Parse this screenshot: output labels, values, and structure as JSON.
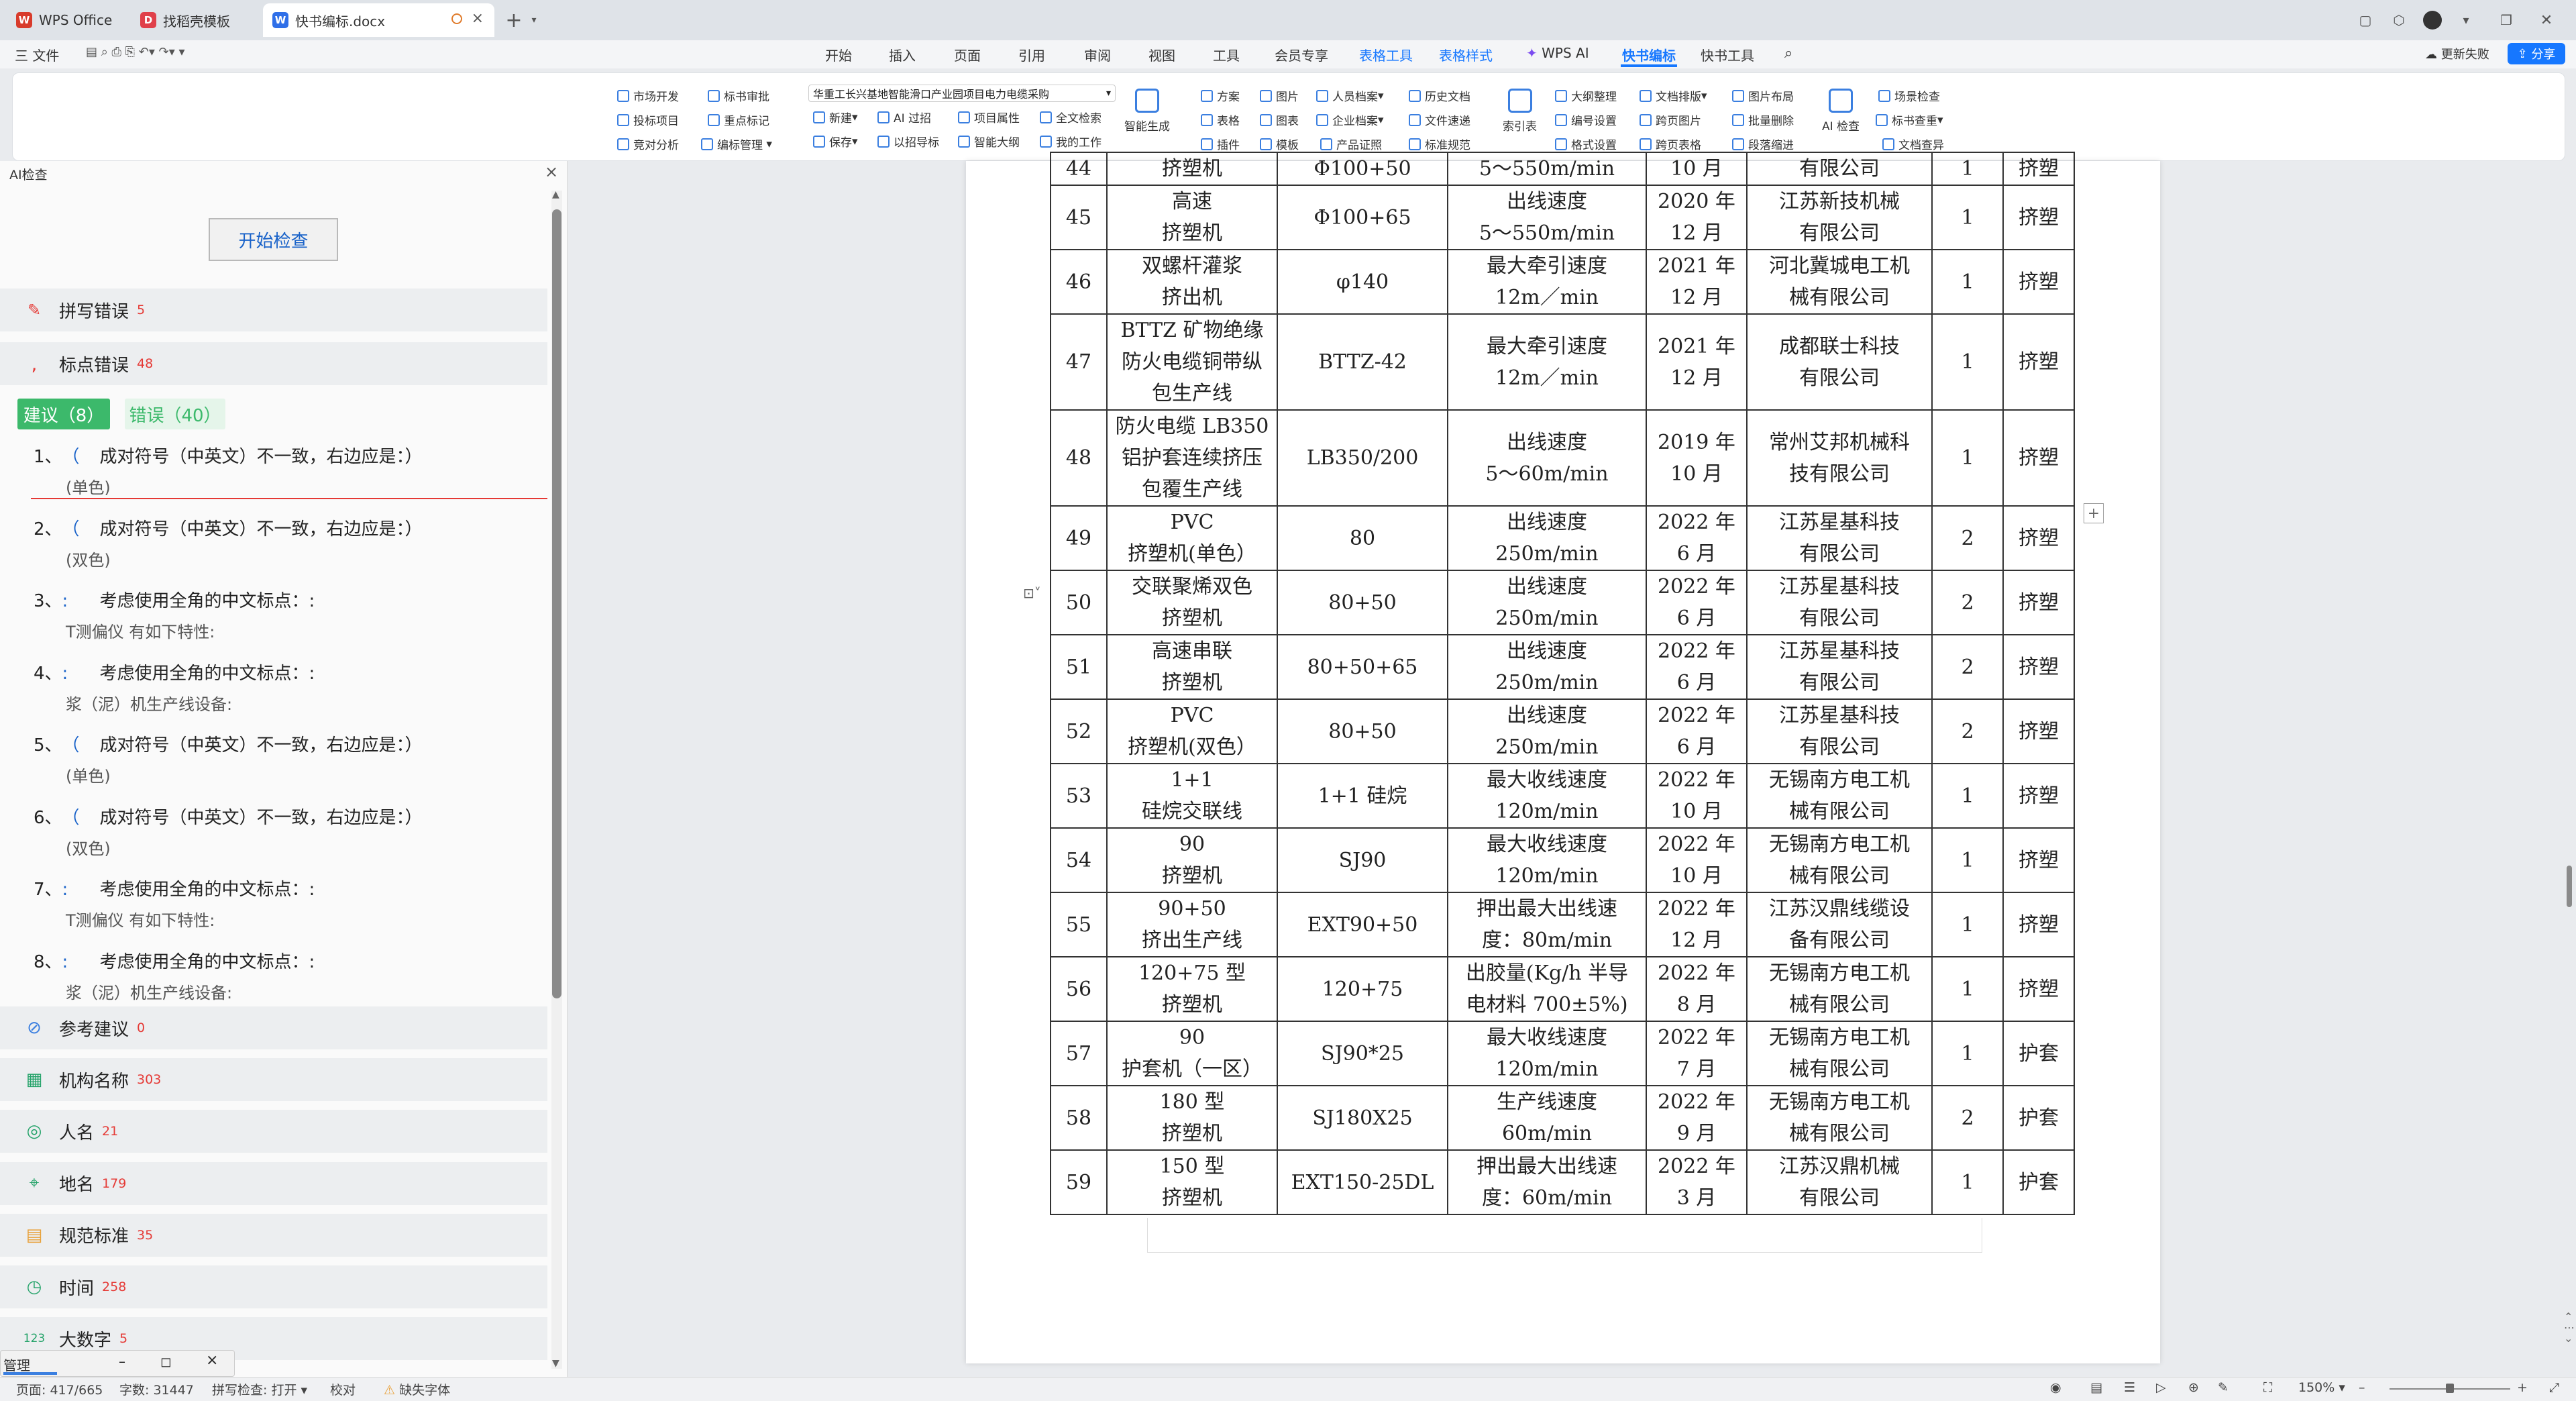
{
  "titlebar": {
    "tabs": [
      {
        "label": "WPS Office",
        "icon": "wps-logo-icon",
        "color": "#d83b2b"
      },
      {
        "label": "找稻壳模板",
        "icon": "daoke-icon",
        "color": "#e0404a"
      },
      {
        "label": "快书编标.docx",
        "icon": "word-doc-icon",
        "color": "#2f6fe8"
      }
    ],
    "new_tab": "+"
  },
  "menubar": {
    "file": "三 文件",
    "items": [
      "开始",
      "插入",
      "页面",
      "引用",
      "审阅",
      "视图",
      "工具",
      "会员专享",
      "表格工具",
      "表格样式",
      "WPS AI",
      "快书编标",
      "快书工具"
    ],
    "active": "快书编标",
    "right": {
      "cloud": "更新失败",
      "share": "分享"
    }
  },
  "ribbon": {
    "g1": [
      "市场开发",
      "投标项目",
      "竞对分析"
    ],
    "g2": [
      "标书审批",
      "重点标记",
      "编标管理"
    ],
    "project_select": "华重工长兴基地智能滑口产业园项目电力电缆采购",
    "g3a": [
      "新建",
      "保存"
    ],
    "g3b": [
      "AI 过招",
      "以招导标"
    ],
    "g3c": [
      "项目属性",
      "智能大纲"
    ],
    "g3d": [
      "全文检索",
      "我的工作"
    ],
    "smart_gen": "智能生成",
    "g4": [
      "方案",
      "表格",
      "插件"
    ],
    "g5": [
      "图片",
      "图表",
      "模板"
    ],
    "g6": [
      "人员档案",
      "企业档案",
      "产品证照"
    ],
    "g7": [
      "历史文档",
      "文件速递",
      "标准规范"
    ],
    "index": "索引表",
    "g8": [
      "大纲整理",
      "编号设置",
      "格式设置"
    ],
    "g9": [
      "文档排版",
      "跨页图片",
      "跨页表格"
    ],
    "g10": [
      "图片布局",
      "批量删除",
      "段落缩进"
    ],
    "ai_check": "AI 检查",
    "g11": [
      "场景检查",
      "标书查重",
      "文档查异"
    ]
  },
  "leftpanel": {
    "title": "AI检查",
    "start_button": "开始检查",
    "spell": {
      "label": "拼写错误",
      "count": "5"
    },
    "punct": {
      "label": "标点错误",
      "count": "48"
    },
    "tab_suggest": "建议（8）",
    "tab_error": "错误（40）",
    "items": [
      {
        "no": "1、",
        "mark": "（",
        "msg": "成对符号（中英文）不一致，右边应是：）",
        "ctx": "(单色)"
      },
      {
        "no": "2、",
        "mark": "（",
        "msg": "成对符号（中英文）不一致，右边应是：）",
        "ctx": "(双色)"
      },
      {
        "no": "3、",
        "mark": ":",
        "msg": "考虑使用全角的中文标点：:",
        "ctx": "T测偏仪 有如下特性:"
      },
      {
        "no": "4、",
        "mark": ":",
        "msg": "考虑使用全角的中文标点：:",
        "ctx": "浆（泥）机生产线设备:"
      },
      {
        "no": "5、",
        "mark": "（",
        "msg": "成对符号（中英文）不一致，右边应是：）",
        "ctx": "(单色)"
      },
      {
        "no": "6、",
        "mark": "（",
        "msg": "成对符号（中英文）不一致，右边应是：）",
        "ctx": "(双色)"
      },
      {
        "no": "7、",
        "mark": ":",
        "msg": "考虑使用全角的中文标点：:",
        "ctx": "T测偏仪 有如下特性:"
      },
      {
        "no": "8、",
        "mark": ":",
        "msg": "考虑使用全角的中文标点：:",
        "ctx": "浆（泥）机生产线设备:"
      }
    ],
    "sections": [
      {
        "label": "参考建议",
        "count": "0",
        "icon": "link-icon",
        "color": "#3b7fe0"
      },
      {
        "label": "机构名称",
        "count": "303",
        "icon": "building-icon",
        "color": "#25a36a"
      },
      {
        "label": "人名",
        "count": "21",
        "icon": "person-icon",
        "color": "#25a36a"
      },
      {
        "label": "地名",
        "count": "179",
        "icon": "map-pin-icon",
        "color": "#25a36a"
      },
      {
        "label": "规范标准",
        "count": "35",
        "icon": "document-icon",
        "color": "#e8a13a"
      },
      {
        "label": "时间",
        "count": "258",
        "icon": "clock-icon",
        "color": "#25a36a"
      },
      {
        "label": "大数字",
        "count": "5",
        "icon": "number-icon",
        "color": "#25a36a"
      }
    ],
    "mini_window": "管理"
  },
  "table": {
    "rows": [
      {
        "no": "44",
        "name": [
          "挤塑机"
        ],
        "model": "Φ100+50",
        "spec": [
          "5～550m/min"
        ],
        "date": [
          "10 月"
        ],
        "maker": [
          "有限公司"
        ],
        "qty": "1",
        "use": "挤塑",
        "partial": true
      },
      {
        "no": "45",
        "name": [
          "高速",
          "挤塑机"
        ],
        "model": "Φ100+65",
        "spec": [
          "出线速度",
          "5～550m/min"
        ],
        "date": [
          "2020 年",
          "12 月"
        ],
        "maker": [
          "江苏新技机械",
          "有限公司"
        ],
        "qty": "1",
        "use": "挤塑"
      },
      {
        "no": "46",
        "name": [
          "双螺杆灌浆",
          "挤出机"
        ],
        "model": "φ140",
        "spec": [
          "最大牵引速度",
          "12m／min"
        ],
        "date": [
          "2021 年",
          "12 月"
        ],
        "maker": [
          "河北冀城电工机",
          "械有限公司"
        ],
        "qty": "1",
        "use": "挤塑"
      },
      {
        "no": "47",
        "name": [
          "BTTZ 矿物绝缘",
          "防火电缆铜带纵",
          "包生产线"
        ],
        "model": "BTTZ-42",
        "spec": [
          "最大牵引速度",
          "12m／min"
        ],
        "date": [
          "2021 年",
          "12 月"
        ],
        "maker": [
          "成都联士科技",
          "有限公司"
        ],
        "qty": "1",
        "use": "挤塑"
      },
      {
        "no": "48",
        "name": [
          "防火电缆 LB350",
          "铝护套连续挤压",
          "包覆生产线"
        ],
        "model": "LB350/200",
        "spec": [
          "出线速度",
          "5～60m/min"
        ],
        "date": [
          "2019 年",
          "10 月"
        ],
        "maker": [
          "常州艾邦机械科",
          "技有限公司"
        ],
        "qty": "1",
        "use": "挤塑"
      },
      {
        "no": "49",
        "name": [
          "PVC",
          "挤塑机(单色）"
        ],
        "model": "80",
        "spec": [
          "出线速度",
          "250m/min"
        ],
        "date": [
          "2022 年",
          "6 月"
        ],
        "maker": [
          "江苏星基科技",
          "有限公司"
        ],
        "qty": "2",
        "use": "挤塑"
      },
      {
        "no": "50",
        "name": [
          "交联聚烯双色",
          "挤塑机"
        ],
        "model": "80+50",
        "spec": [
          "出线速度",
          "250m/min"
        ],
        "date": [
          "2022 年",
          "6 月"
        ],
        "maker": [
          "江苏星基科技",
          "有限公司"
        ],
        "qty": "2",
        "use": "挤塑"
      },
      {
        "no": "51",
        "name": [
          "高速串联",
          "挤塑机"
        ],
        "model": "80+50+65",
        "spec": [
          "出线速度",
          "250m/min"
        ],
        "date": [
          "2022 年",
          "6 月"
        ],
        "maker": [
          "江苏星基科技",
          "有限公司"
        ],
        "qty": "2",
        "use": "挤塑"
      },
      {
        "no": "52",
        "name": [
          "PVC",
          "挤塑机(双色）"
        ],
        "model": "80+50",
        "spec": [
          "出线速度",
          "250m/min"
        ],
        "date": [
          "2022 年",
          "6 月"
        ],
        "maker": [
          "江苏星基科技",
          "有限公司"
        ],
        "qty": "2",
        "use": "挤塑"
      },
      {
        "no": "53",
        "name": [
          "1+1",
          "硅烷交联线"
        ],
        "model": "1+1 硅烷",
        "spec": [
          "最大收线速度",
          "120m/min"
        ],
        "date": [
          "2022 年",
          "10 月"
        ],
        "maker": [
          "无锡南方电工机",
          "械有限公司"
        ],
        "qty": "1",
        "use": "挤塑"
      },
      {
        "no": "54",
        "name": [
          "90",
          "挤塑机"
        ],
        "model": "SJ90",
        "spec": [
          "最大收线速度",
          "120m/min"
        ],
        "date": [
          "2022 年",
          "10 月"
        ],
        "maker": [
          "无锡南方电工机",
          "械有限公司"
        ],
        "qty": "1",
        "use": "挤塑"
      },
      {
        "no": "55",
        "name": [
          "90+50",
          "挤出生产线"
        ],
        "model": "EXT90+50",
        "spec": [
          "押出最大出线速",
          "度：80m/min"
        ],
        "date": [
          "2022 年",
          "12 月"
        ],
        "maker": [
          "江苏汉鼎线缆设",
          "备有限公司"
        ],
        "qty": "1",
        "use": "挤塑"
      },
      {
        "no": "56",
        "name": [
          "120+75 型",
          "挤塑机"
        ],
        "model": "120+75",
        "spec": [
          "出胶量(Kg/h 半导",
          "电材料 700±5%)"
        ],
        "date": [
          "2022 年",
          "8 月"
        ],
        "maker": [
          "无锡南方电工机",
          "械有限公司"
        ],
        "qty": "1",
        "use": "挤塑"
      },
      {
        "no": "57",
        "name": [
          "90",
          "护套机（一区）"
        ],
        "model": "SJ90*25",
        "spec": [
          "最大收线速度",
          "120m/min"
        ],
        "date": [
          "2022 年",
          "7 月"
        ],
        "maker": [
          "无锡南方电工机",
          "械有限公司"
        ],
        "qty": "1",
        "use": "护套"
      },
      {
        "no": "58",
        "name": [
          "180 型",
          "挤塑机"
        ],
        "model": "SJ180X25",
        "spec": [
          "生产线速度",
          "60m/min"
        ],
        "date": [
          "2022 年",
          "9 月"
        ],
        "maker": [
          "无锡南方电工机",
          "械有限公司"
        ],
        "qty": "2",
        "use": "护套"
      },
      {
        "no": "59",
        "name": [
          "150 型",
          "挤塑机"
        ],
        "model": "EXT150-25DL",
        "spec": [
          "押出最大出线速",
          "度：60m/min"
        ],
        "date": [
          "2022 年",
          "3 月"
        ],
        "maker": [
          "江苏汉鼎机械",
          "有限公司"
        ],
        "qty": "1",
        "use": "护套"
      }
    ]
  },
  "statusbar": {
    "page": "页面: 417/665",
    "words": "字数: 31447",
    "spell": "拼写检查: 打开",
    "proof": "校对",
    "font": "缺失字体",
    "zoom": "150%"
  }
}
